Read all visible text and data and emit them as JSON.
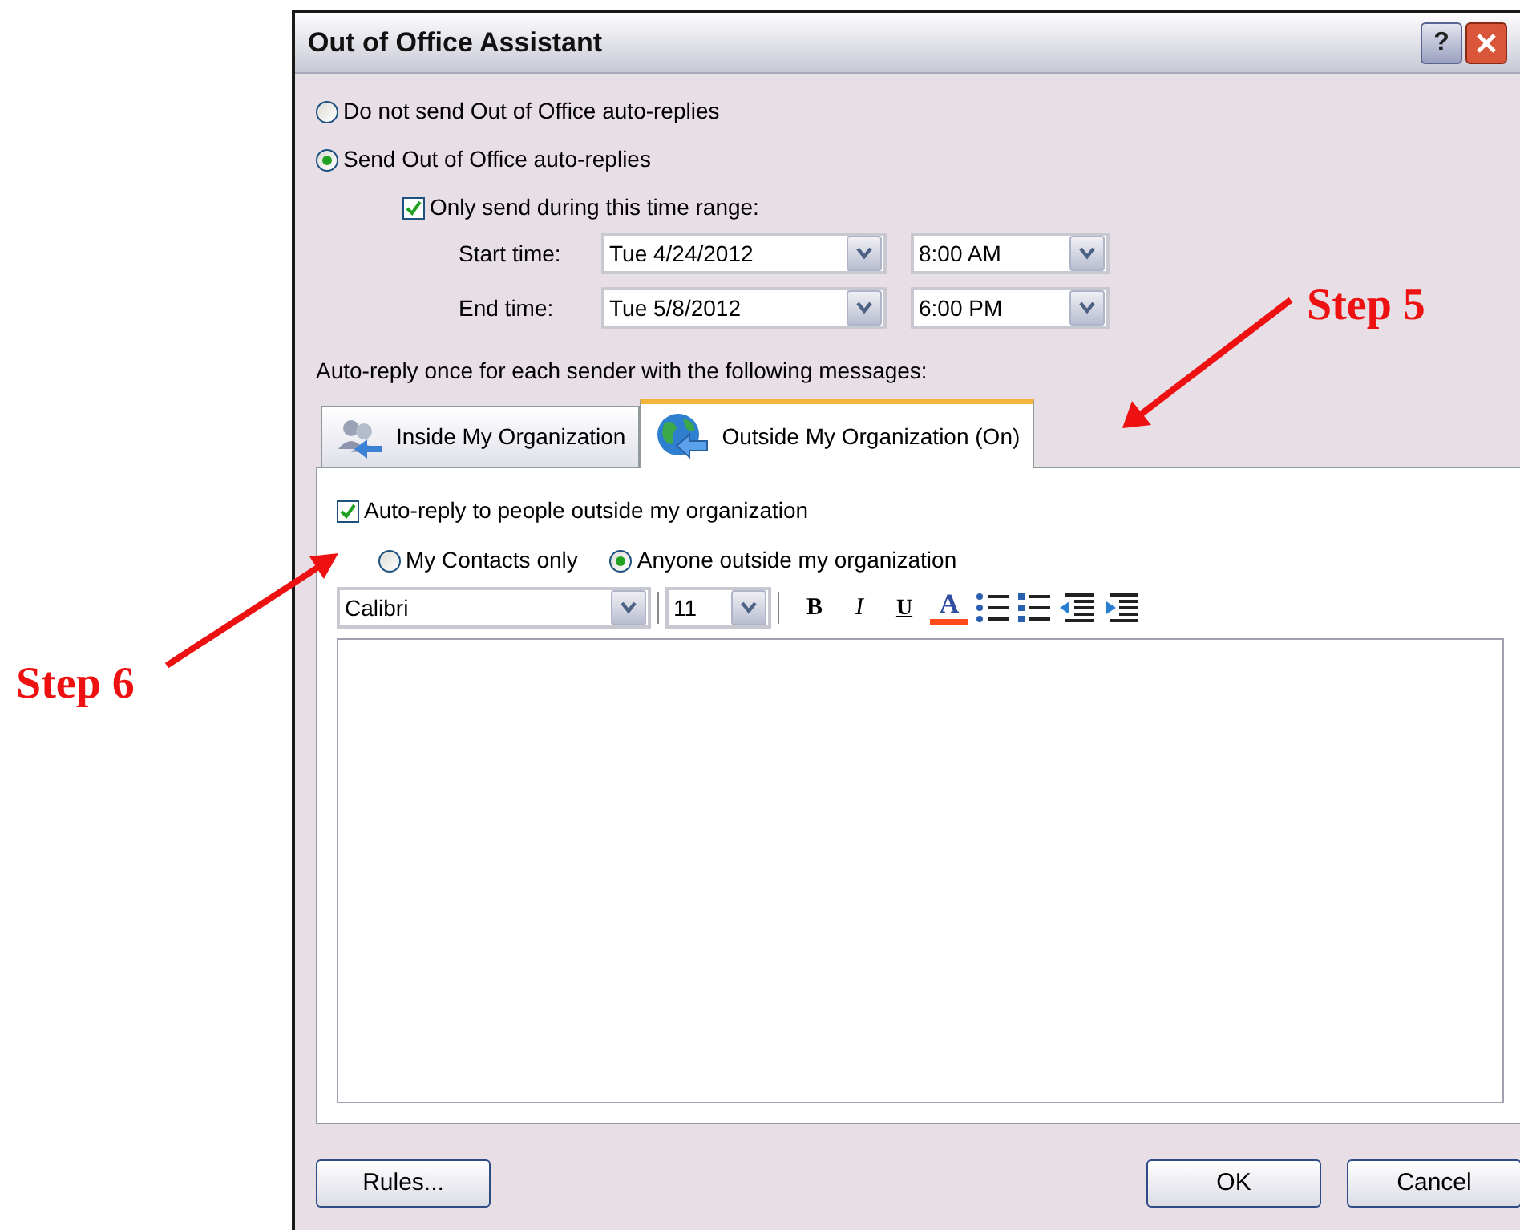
{
  "window": {
    "title": "Out of Office Assistant",
    "help": "?"
  },
  "send_options": [
    {
      "label": "Do not send Out of Office auto-replies",
      "selected": false
    },
    {
      "label": "Send Out of Office auto-replies",
      "selected": true
    }
  ],
  "time_range": {
    "label": "Only send during this time range:",
    "checked": true
  },
  "times": [
    {
      "label": "Start time:",
      "date": "Tue 4/24/2012",
      "time": "8:00 AM"
    },
    {
      "label": "End time:",
      "date": "Tue 5/8/2012",
      "time": "6:00 PM"
    }
  ],
  "messages_label": "Auto-reply once for each sender with the following messages:",
  "tabs": [
    {
      "label": "Inside My Organization",
      "selected": false,
      "kind": "people"
    },
    {
      "label": "Outside My Organization (On)",
      "selected": true,
      "kind": "globe"
    }
  ],
  "auto_reply": {
    "label": "Auto-reply to people outside my organization",
    "checked": true
  },
  "audience": [
    {
      "label": "My Contacts only",
      "selected": false
    },
    {
      "label": "Anyone outside my organization",
      "selected": true
    }
  ],
  "toolbar": {
    "font": "Calibri",
    "size": "11",
    "buttons": [
      {
        "kind": "bold",
        "label": "B"
      },
      {
        "kind": "italic",
        "label": "I"
      },
      {
        "kind": "underline",
        "label": "U"
      },
      {
        "kind": "font-color",
        "label": "A"
      },
      {
        "kind": "bullets"
      },
      {
        "kind": "numbering"
      },
      {
        "kind": "outdent"
      },
      {
        "kind": "indent"
      }
    ]
  },
  "buttons": {
    "rules": "Rules...",
    "ok": "OK",
    "cancel": "Cancel"
  },
  "annotations": [
    {
      "label": "Step 5"
    },
    {
      "label": "Step 6"
    }
  ]
}
